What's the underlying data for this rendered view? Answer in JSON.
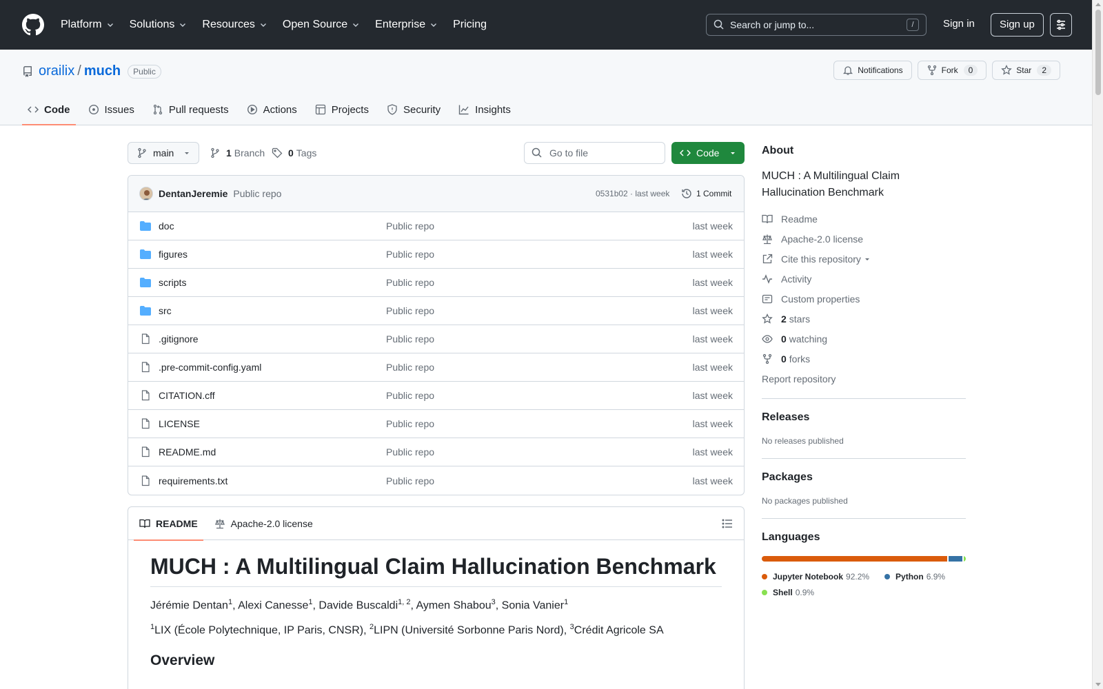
{
  "topnav": {
    "items": [
      "Platform",
      "Solutions",
      "Resources",
      "Open Source",
      "Enterprise",
      "Pricing"
    ],
    "search_placeholder": "Search or jump to...",
    "search_key": "/",
    "signin": "Sign in",
    "signup": "Sign up"
  },
  "repo": {
    "owner": "orailix",
    "separator": "/",
    "name": "much",
    "visibility": "Public",
    "notifications": "Notifications",
    "fork_label": "Fork",
    "fork_count": "0",
    "star_label": "Star",
    "star_count": "2"
  },
  "tabs": [
    "Code",
    "Issues",
    "Pull requests",
    "Actions",
    "Projects",
    "Security",
    "Insights"
  ],
  "branch": {
    "name": "main",
    "branch_count": "1",
    "branch_label": "Branch",
    "tag_count": "0",
    "tag_label": "Tags",
    "goto_placeholder": "Go to file",
    "code_button": "Code"
  },
  "commit": {
    "author": "DentanJeremie",
    "message": "Public repo",
    "meta": "0531b02 · last week",
    "count": "1 Commit"
  },
  "files": [
    {
      "name": "doc",
      "type": "folder",
      "message": "Public repo",
      "date": "last week"
    },
    {
      "name": "figures",
      "type": "folder",
      "message": "Public repo",
      "date": "last week"
    },
    {
      "name": "scripts",
      "type": "folder",
      "message": "Public repo",
      "date": "last week"
    },
    {
      "name": "src",
      "type": "folder",
      "message": "Public repo",
      "date": "last week"
    },
    {
      "name": ".gitignore",
      "type": "file",
      "message": "Public repo",
      "date": "last week"
    },
    {
      "name": ".pre-commit-config.yaml",
      "type": "file",
      "message": "Public repo",
      "date": "last week"
    },
    {
      "name": "CITATION.cff",
      "type": "file",
      "message": "Public repo",
      "date": "last week"
    },
    {
      "name": "LICENSE",
      "type": "file",
      "message": "Public repo",
      "date": "last week"
    },
    {
      "name": "README.md",
      "type": "file",
      "message": "Public repo",
      "date": "last week"
    },
    {
      "name": "requirements.txt",
      "type": "file",
      "message": "Public repo",
      "date": "last week"
    }
  ],
  "readme": {
    "tab_readme": "README",
    "tab_license": "Apache-2.0 license",
    "title": "MUCH : A Multilingual Claim Hallucination Benchmark",
    "authors": [
      {
        "name": "Jérémie Dentan",
        "sup": "1",
        "sep": ", "
      },
      {
        "name": "Alexi Canesse",
        "sup": "1",
        "sep": ", "
      },
      {
        "name": "Davide Buscaldi",
        "sup": "1, 2",
        "sep": ", "
      },
      {
        "name": "Aymen Shabou",
        "sup": "3",
        "sep": ", "
      },
      {
        "name": "Sonia Vanier",
        "sup": "1",
        "sep": ""
      }
    ],
    "affiliations": [
      {
        "sup": "1",
        "text": "LIX (École Polytechnique, IP Paris, CNSR), "
      },
      {
        "sup": "2",
        "text": "LIPN (Université Sorbonne Paris Nord), "
      },
      {
        "sup": "3",
        "text": "Crédit Agricole SA"
      }
    ],
    "overview": "Overview"
  },
  "about": {
    "heading": "About",
    "description": "MUCH : A Multilingual Claim Hallucination Benchmark",
    "readme": "Readme",
    "license": "Apache-2.0 license",
    "cite": "Cite this repository",
    "activity": "Activity",
    "custom_properties": "Custom properties",
    "stars_count": "2",
    "stars_label": "stars",
    "watching_count": "0",
    "watching_label": "watching",
    "forks_count": "0",
    "forks_label": "forks",
    "report": "Report repository"
  },
  "releases": {
    "heading": "Releases",
    "empty": "No releases published"
  },
  "packages": {
    "heading": "Packages",
    "empty": "No packages published"
  },
  "languages": {
    "heading": "Languages",
    "items": [
      {
        "name": "Jupyter Notebook",
        "percent": "92.2%",
        "share": 92.2,
        "color": "#DA5B0B"
      },
      {
        "name": "Python",
        "percent": "6.9%",
        "share": 6.9,
        "color": "#3572A5"
      },
      {
        "name": "Shell",
        "percent": "0.9%",
        "share": 0.9,
        "color": "#89e051"
      }
    ]
  },
  "colors": {
    "header_bg": "#24292f",
    "link": "#0969da",
    "green": "#1f883d",
    "tab_underline": "#fd8c73"
  }
}
